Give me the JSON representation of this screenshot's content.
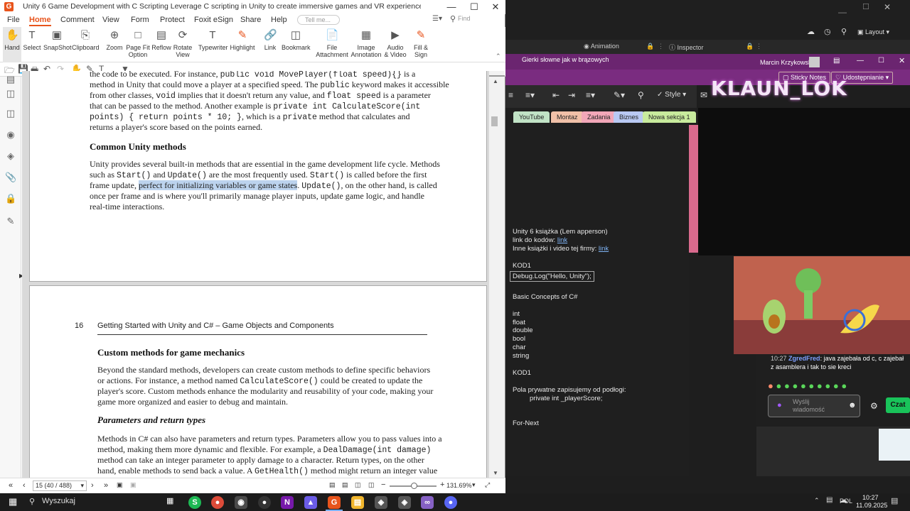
{
  "foxit": {
    "title": "Unity 6 Game Development with C Scripting Leverage C scripting in Unity to create immersive games and VR experiences (Lem Apperson).pdf * - Foxit PDF R...",
    "menu": [
      "File",
      "Home",
      "Comment",
      "View",
      "Form",
      "Protect",
      "Foxit eSign",
      "Share",
      "Help"
    ],
    "search_placeholder": "Tell me...",
    "find_placeholder": "Find",
    "ribbon": [
      [
        "Hand",
        ""
      ],
      [
        "Select",
        ""
      ],
      [
        "SnapShot",
        ""
      ],
      [
        "Clipboard",
        ""
      ],
      [
        "Zoom",
        ""
      ],
      [
        "Page Fit",
        "Option"
      ],
      [
        "Reflow",
        ""
      ],
      [
        "Rotate",
        "View"
      ],
      [
        "Typewriter",
        ""
      ],
      [
        "Highlight",
        ""
      ],
      [
        "Link",
        ""
      ],
      [
        "Bookmark",
        ""
      ],
      [
        "File",
        "Attachment"
      ],
      [
        "Image",
        "Annotation"
      ],
      [
        "Audio",
        "& Video"
      ],
      [
        "Fill &",
        "Sign"
      ]
    ],
    "page1": {
      "p0a": "the code to be executed. For instance, ",
      "p0b": "public void MovePlayer(float speed){}",
      "p0c": " is a",
      "p1": "method in Unity that could move a player at a specified speed. The ",
      "p1code": "public",
      "p1b": " keyword makes it accessible",
      "p2a": "from other classes, ",
      "p2code": "void",
      "p2b": " implies that it doesn't return any value, and ",
      "p2code2": "float speed",
      "p2c": " is a parameter",
      "p3a": "that can be passed to the method. Another example is ",
      "p3code": "private int CalculateScore(int",
      "p4code": "points) { return points * 10; }",
      "p4b": ", which is a ",
      "p4code2": "private",
      "p4c": " method that calculates and",
      "p5": "returns a player's score based on the points earned.",
      "heading": "Common Unity methods",
      "q1": "Unity provides several built-in methods that are essential in the game development life cycle. Methods",
      "q2a": "such as ",
      "q2code": "Start()",
      "q2b": " and ",
      "q2code2": "Update()",
      "q2c": " are the most frequently used. ",
      "q2code3": "Start()",
      "q2d": " is called before the first",
      "q3a": "frame update, ",
      "q3hl": "perfect for initializing variables or game states",
      "q3b": ". ",
      "q3code": "Update()",
      "q3c": ", on the other hand, is called",
      "q4": "once per frame and is where you'll primarily manage player inputs, update game logic, and handle",
      "q5": "real-time interactions."
    },
    "page2": {
      "pagenum": "16",
      "running": "Getting Started with Unity and C# – Game Objects and Components",
      "h1": "Custom methods for game mechanics",
      "r1": "Beyond the standard methods, developers can create custom methods to define specific behaviors",
      "r2a": "or actions. For instance, a method named ",
      "r2code": "CalculateScore()",
      "r2b": " could be created to update the",
      "r3": "player's score. Custom methods enhance the modularity and reusability of your code, making your",
      "r4": "game more organized and easier to debug and maintain.",
      "h2": "Parameters and return types",
      "s1": "Methods in C# can also have parameters and return types. Parameters allow you to pass values into a",
      "s2a": "method, making them more dynamic and flexible. For example, a ",
      "s2code": "DealDamage(int damage)",
      "s3": "method can take an integer parameter to apply damage to a character. Return types, on the other",
      "s4a": "hand, enable methods to send back a value. A ",
      "s4code": "GetHealth()",
      "s4b": " method might return an integer value"
    },
    "status": {
      "page": "15 (40 / 488)",
      "zoom": "131.69%"
    }
  },
  "unity": {
    "tab_animation": "Animation",
    "tab_inspector": "Inspector",
    "layout": "Layout"
  },
  "onenote": {
    "title": "Gierki słowne jak w brązowych",
    "user": "Marcin Krzykowski",
    "sticky": "Sticky Notes",
    "share": "Udostępnianie",
    "style": "Style",
    "sections": [
      "YouTube",
      "Montaz",
      "Zadania",
      "Biznes",
      "Nowa sekcja 1"
    ],
    "lines": [
      "Unity 6 książka (Lem apperson)",
      "link do kodów: ",
      "Inne książki i video tej firmy: ",
      "KOD1",
      "Debug.Log(\"Hello, Unity\");",
      "Basic Concepts of C#",
      "int",
      "float",
      "double",
      "bool",
      "char",
      "string",
      "KOD1",
      "Pola prywatne zapisujemy od podłogi:",
      "private int _playerScore;",
      "For-Next"
    ],
    "link": "link"
  },
  "stream": {
    "overlay": "KLAUN_LOK"
  },
  "chat": {
    "time": "10:27",
    "user": "ZgredFred",
    "msg": ": java zajebała od c, c zajebał z asamblera i tak to sie kreci",
    "input_placeholder": "Wyślij wiadomość",
    "send": "Czat"
  },
  "taskbar": {
    "search": "Wyszukaj",
    "lang": "POL",
    "time": "10:27",
    "date": "11.09.2025"
  }
}
